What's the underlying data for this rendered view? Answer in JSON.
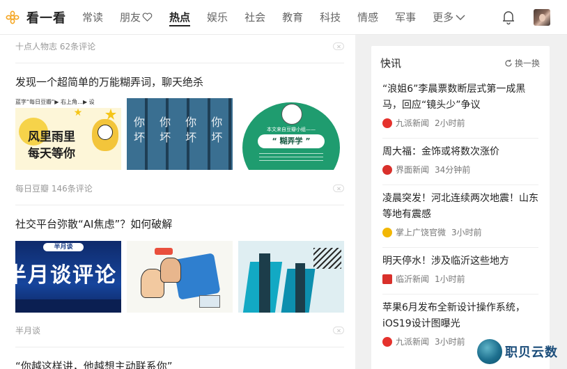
{
  "header": {
    "logo_text": "看一看",
    "tabs": [
      {
        "label": "常读",
        "active": false
      },
      {
        "label": "朋友",
        "active": false
      },
      {
        "label": "热点",
        "active": true
      },
      {
        "label": "娱乐",
        "active": false
      },
      {
        "label": "社会",
        "active": false
      },
      {
        "label": "教育",
        "active": false
      },
      {
        "label": "科技",
        "active": false
      },
      {
        "label": "情感",
        "active": false
      },
      {
        "label": "军事",
        "active": false
      },
      {
        "label": "更多",
        "active": false
      }
    ]
  },
  "feed": {
    "items": [
      {
        "meta": "十点人物志 62条评论"
      },
      {
        "title": "发现一个超简单的万能糊弄词，聊天绝杀",
        "meta": "每日豆瓣 146条评论",
        "thumb_texts": {
          "t1_top": "蓝字“每日豆瓣”▶ 右上角…▶ 设",
          "t1_main": "风里雨里\n每天等你",
          "t2": "你 你 你 你 你\n坏 坏 坏 坏 坏",
          "t3_line": "本文来自豆瓣小组——",
          "t3_main": "“ 糊弄学 ”"
        }
      },
      {
        "title": "社交平台弥散“AI焦虑”？如何破解",
        "meta": "半月谈",
        "thumb_texts": {
          "t1_badge": "半月谈",
          "t1_main": "半月谈评论"
        }
      },
      {
        "title": "“你越这样讲，他越想主动联系你”"
      }
    ]
  },
  "quick": {
    "title": "快讯",
    "refresh": "换一换",
    "items": [
      {
        "title": "“浪姐6”李晨票数断层式第一成黑马，回应“镜头少”争议",
        "source": "九派新闻",
        "time": "2小时前",
        "color": "#e5322d"
      },
      {
        "title": "周大福：金饰或将数次涨价",
        "source": "界面新闻",
        "time": "34分钟前",
        "color": "#d9302b"
      },
      {
        "title": "凌晨突发！河北连续两次地震！山东等地有震感",
        "source": "掌上广饶官微",
        "time": "3小时前",
        "color": "#f2b705"
      },
      {
        "title": "明天停水！涉及临沂这些地方",
        "source": "临沂新闻",
        "time": "1小时前",
        "color": "#d9302b"
      },
      {
        "title": "苹果6月发布全新设计操作系统，iOS19设计图曝光",
        "source": "九派新闻",
        "time": "3小时前",
        "color": "#e5322d"
      }
    ]
  },
  "watermark": {
    "text": "职贝云数"
  }
}
